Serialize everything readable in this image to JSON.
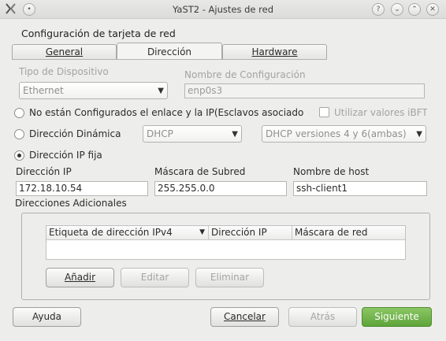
{
  "window": {
    "title": "YaST2 - Ajustes de red",
    "app_icon": "yast-icon",
    "controls": [
      "help-icon",
      "minimize-icon",
      "maximize-icon",
      "close-icon"
    ]
  },
  "heading": "Configuración de tarjeta de red",
  "tabs": [
    {
      "label": "General"
    },
    {
      "label": "Dirección"
    },
    {
      "label": "Hardware"
    }
  ],
  "device_type": {
    "label": "Tipo de Dispositivo",
    "value": "Ethernet"
  },
  "config_name": {
    "label": "Nombre de Configuración",
    "value": "enp0s3"
  },
  "options": {
    "unconfigured": "No están Configurados el enlace y la IP(Esclavos asociado",
    "ibft_checkbox": "Utilizar valores iBFT",
    "dynamic": "Dirección Dinámica",
    "dhcp_value": "DHCP",
    "dhcp_version": "DHCP versiones 4 y 6(ambas)",
    "static": "Dirección IP fija"
  },
  "static_ip": {
    "ip_label": "Dirección IP",
    "ip_value": "172.18.10.54",
    "mask_label": "Máscara de Subred",
    "mask_value": "255.255.0.0",
    "host_label": "Nombre de host",
    "host_value": "ssh-client1"
  },
  "additional": {
    "label": "Direcciones Adicionales",
    "columns": [
      "Etiqueta de dirección IPv4",
      "Dirección IP",
      "Máscara de red"
    ],
    "add": "Añadir",
    "edit": "Editar",
    "delete": "Eliminar"
  },
  "footer": {
    "help": "Ayuda",
    "cancel": "Cancelar",
    "back": "Atrás",
    "next": "Siguiente"
  },
  "colors": {
    "accent_green": "#6aae45",
    "background": "#ededeb"
  }
}
